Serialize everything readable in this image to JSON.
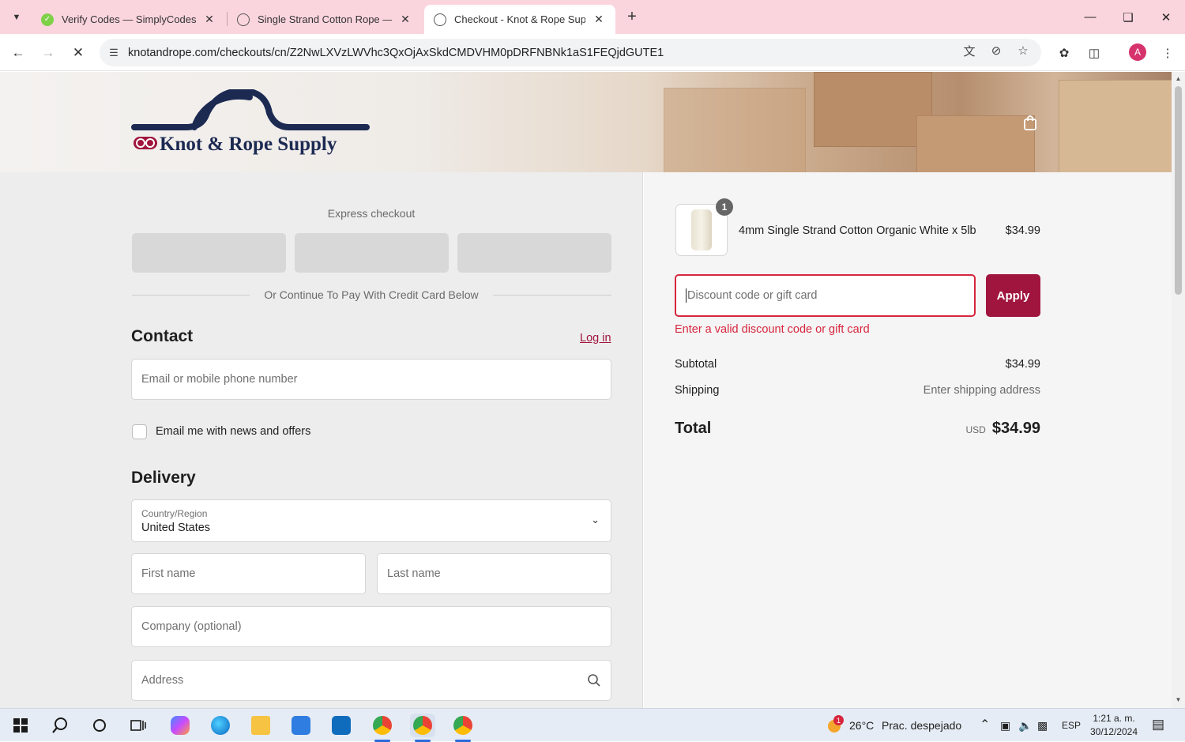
{
  "browser": {
    "tabs": [
      {
        "title": "Verify Codes — SimplyCodes",
        "active": false
      },
      {
        "title": "Single Strand Cotton Rope — K",
        "active": false
      },
      {
        "title": "Checkout - Knot & Rope Suppl",
        "active": true
      }
    ],
    "url": "knotandrope.com/checkouts/cn/Z2NwLXVzLWVhc3QxOjAxSkdCMDVHM0pDRFNBNk1aS1FEQjdGUTE1",
    "profile_initial": "A"
  },
  "header": {
    "brand": "Knot & Rope Supply"
  },
  "checkout": {
    "express_label": "Express checkout",
    "divider_text": "Or Continue To Pay With Credit Card Below",
    "contact": {
      "heading": "Contact",
      "login_label": "Log in",
      "email_placeholder": "Email or mobile phone number",
      "newsletter_label": "Email me with news and offers"
    },
    "delivery": {
      "heading": "Delivery",
      "country_label": "Country/Region",
      "country_value": "United States",
      "first_name_placeholder": "First name",
      "last_name_placeholder": "Last name",
      "company_placeholder": "Company (optional)",
      "address_placeholder": "Address"
    }
  },
  "summary": {
    "item": {
      "name": "4mm Single Strand Cotton Organic White x 5lb",
      "price": "$34.99",
      "quantity": "1"
    },
    "discount_placeholder": "Discount code or gift card",
    "apply_label": "Apply",
    "error": "Enter a valid discount code or gift card",
    "subtotal_label": "Subtotal",
    "subtotal_value": "$34.99",
    "shipping_label": "Shipping",
    "shipping_value": "Enter shipping address",
    "total_label": "Total",
    "currency": "USD",
    "total_value": "$34.99"
  },
  "taskbar": {
    "weather_temp": "26°C",
    "weather_desc": "Prac. despejado",
    "weather_badge": "1",
    "language": "ESP",
    "time": "1:21 a. m.",
    "date": "30/12/2024"
  },
  "colors": {
    "accent": "#a0153e",
    "error": "#d7263d",
    "tabbar": "#fbd5dd",
    "logo_navy": "#1c2a52"
  }
}
